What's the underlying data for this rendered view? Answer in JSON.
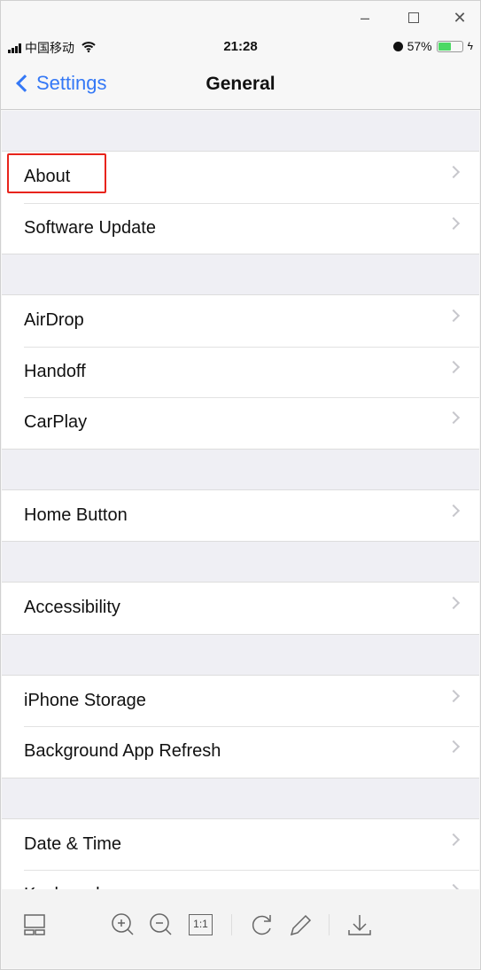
{
  "window": {
    "minimize_icon": "minus",
    "maximize_icon": "square",
    "close_icon": "x"
  },
  "status": {
    "carrier": "中国移动",
    "time": "21:28",
    "battery": "57%",
    "battery_level": 0.57,
    "accent_battery": "#4cd964"
  },
  "nav": {
    "back_label": "Settings",
    "title": "General",
    "accent": "#3478f6"
  },
  "groups": [
    [
      "About",
      "Software Update"
    ],
    [
      "AirDrop",
      "Handoff",
      "CarPlay"
    ],
    [
      "Home Button"
    ],
    [
      "Accessibility"
    ],
    [
      "iPhone Storage",
      "Background App Refresh"
    ],
    [
      "Date & Time",
      "Keyboard"
    ]
  ],
  "highlight": {
    "item": "About",
    "color": "#e8241b"
  },
  "toolbar": {
    "icons": [
      "thumbnail-layout",
      "zoom-in",
      "zoom-out",
      "actual-size",
      "rotate",
      "edit-pencil",
      "download"
    ],
    "actual_size_label": "1:1"
  }
}
